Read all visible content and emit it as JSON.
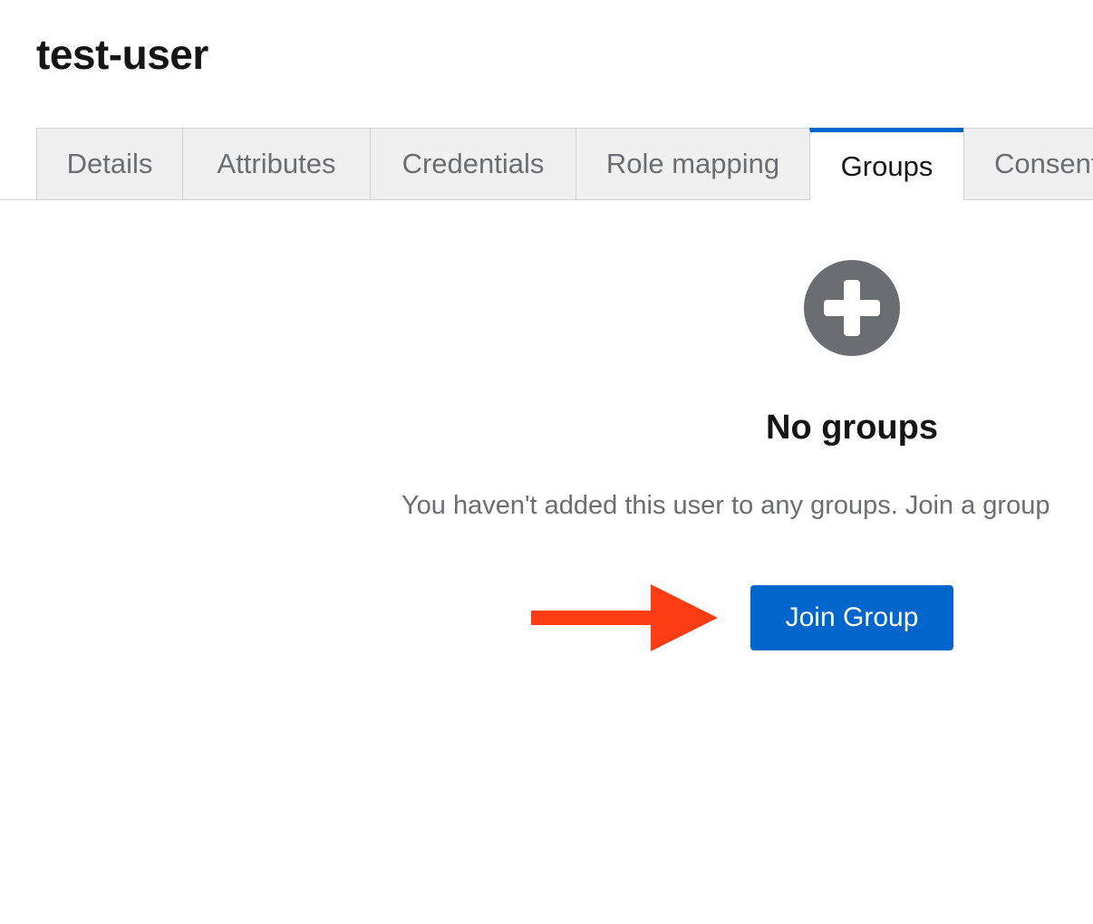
{
  "page": {
    "title": "test-user"
  },
  "tabs": [
    {
      "label": "Details",
      "active": false
    },
    {
      "label": "Attributes",
      "active": false
    },
    {
      "label": "Credentials",
      "active": false
    },
    {
      "label": "Role mapping",
      "active": false
    },
    {
      "label": "Groups",
      "active": true
    },
    {
      "label": "Consent",
      "active": false
    }
  ],
  "empty_state": {
    "icon": "plus-circle-icon",
    "title": "No groups",
    "body": "You haven't added this user to any groups. Join a group",
    "button_label": "Join Group"
  },
  "annotation": {
    "arrow_icon": "arrow-right-icon"
  },
  "colors": {
    "accent": "#0066cc",
    "annotation": "#ff3d14",
    "icon": "#6a6e73"
  }
}
